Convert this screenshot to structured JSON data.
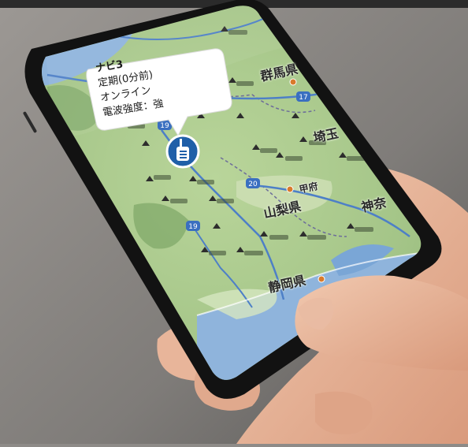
{
  "callout": {
    "title": "ナビ3",
    "line1": "定期(0分前)",
    "line2": "オンライン",
    "line3": "電波強度：強"
  },
  "map_labels": {
    "gunma": "群馬県",
    "yamanashi": "山梨県",
    "shizuoka": "静岡県",
    "saitama": "埼玉",
    "kanagawa": "神奈",
    "kofu": "甲府"
  },
  "route_numbers": {
    "r19": "19",
    "r20": "20",
    "r17": "17"
  },
  "icons": {
    "device_marker": "radio-device-icon"
  },
  "colors": {
    "marker": "#1f5fa8",
    "map_green": "#a9c98a",
    "water": "#8fb4dc"
  }
}
